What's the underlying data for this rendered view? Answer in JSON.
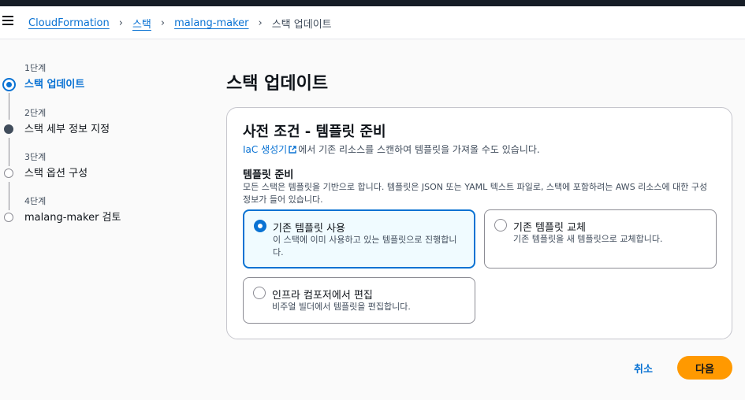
{
  "breadcrumb": {
    "items": [
      "CloudFormation",
      "스택",
      "malang-maker"
    ],
    "current": "스택 업데이트"
  },
  "steps": [
    {
      "num": "1단계",
      "label": "스택 업데이트",
      "state": "active"
    },
    {
      "num": "2단계",
      "label": "스택 세부 정보 지정",
      "state": "filled"
    },
    {
      "num": "3단계",
      "label": "스택 옵션 구성",
      "state": "empty"
    },
    {
      "num": "4단계",
      "label": "malang-maker 검토",
      "state": "empty"
    }
  ],
  "page_title": "스택 업데이트",
  "panel": {
    "title": "사전 조건 - 템플릿 준비",
    "sub_link": "IaC 생성기",
    "sub_text": "에서 기존 리소스를 스캔하여 템플릿을 가져올 수도 있습니다.",
    "field_label": "템플릿 준비",
    "field_desc": "모든 스택은 템플릿을 기반으로 합니다. 템플릿은 JSON 또는 YAML 텍스트 파일로, 스택에 포함하려는 AWS 리소스에 대한 구성 정보가 들어 있습니다.",
    "options": [
      {
        "title": "기존 템플릿 사용",
        "desc": "이 스택에 이미 사용하고 있는 템플릿으로 진행합니다.",
        "selected": true
      },
      {
        "title": "기존 템플릿 교체",
        "desc": "기존 템플릿을 새 템플릿으로 교체합니다.",
        "selected": false
      },
      {
        "title": "인프라 컴포저에서 편집",
        "desc": "비주얼 빌더에서 템플릿을 편집합니다.",
        "selected": false
      }
    ]
  },
  "actions": {
    "cancel": "취소",
    "next": "다음"
  },
  "colors": {
    "accent": "#0972d3",
    "primary_button": "#ff9900",
    "selected_tile_bg": "#f0fbff"
  }
}
